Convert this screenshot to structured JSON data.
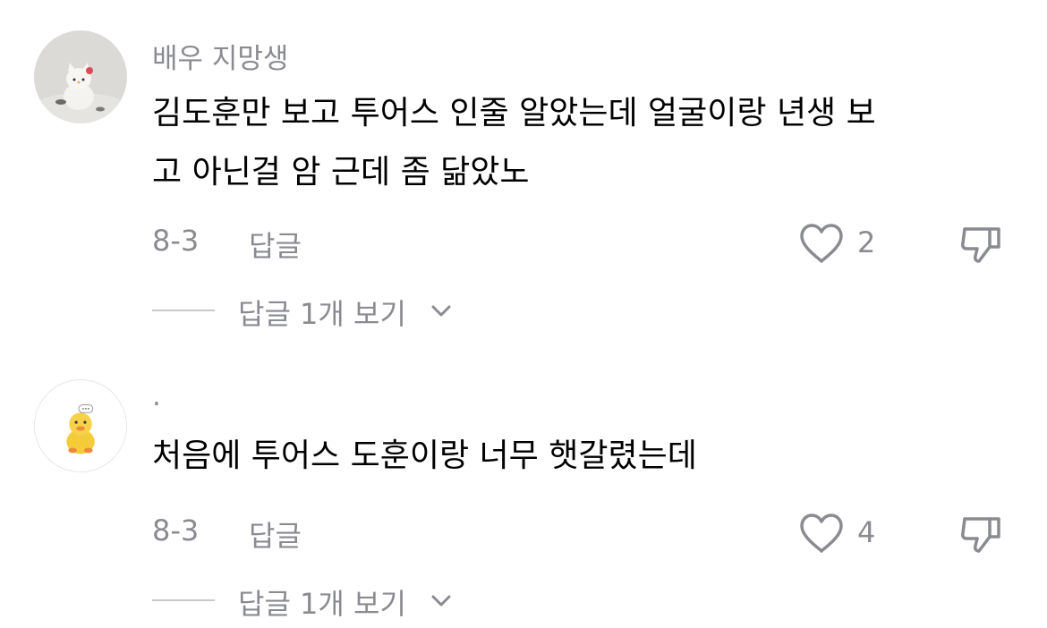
{
  "comments": [
    {
      "username": "배우 지망생",
      "avatar_icon": "hello-kitty-snowman-avatar",
      "lines": [
        "김도훈만 보고 투어스 인줄 알았는데 얼굴이랑 년생 보",
        "고 아닌걸 암 근데 좀 닮았노"
      ],
      "date": "8-3",
      "reply_label": "답글",
      "like_count": "2",
      "view_replies_label": "답글 1개 보기"
    },
    {
      "username": "·",
      "avatar_icon": "yellow-duck-avatar",
      "lines": [
        "처음에 투어스 도훈이랑 너무 햇갈렸는데"
      ],
      "date": "8-3",
      "reply_label": "답글",
      "like_count": "4",
      "view_replies_label": "답글 1개 보기"
    }
  ],
  "colors": {
    "meta_gray": "#8a8b91",
    "text": "#000000",
    "divider": "#c7c8cc"
  }
}
